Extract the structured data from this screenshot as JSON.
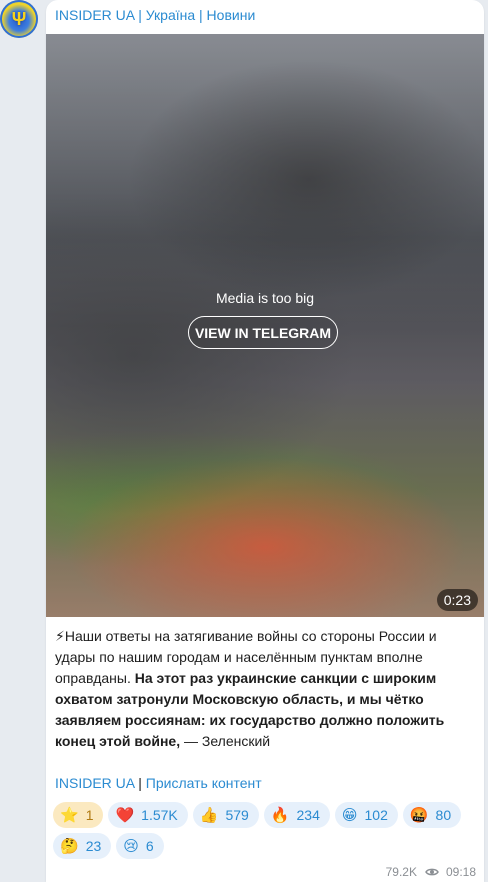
{
  "channel": {
    "name": "INSIDER UA | Україна | Новини"
  },
  "media": {
    "message": "Media is too big",
    "button_label": "VIEW IN TELEGRAM",
    "duration": "0:23"
  },
  "post": {
    "emoji": "⚡",
    "text_regular": "Наши ответы на затягивание войны со стороны России и удары по нашим городам и населённым пунктам вполне оправданы. ",
    "text_bold": "На этот раз украинские санкции с широким охватом затронули Московскую область, и мы чётко заявляем россиянам: их государство должно положить конец этой войне,",
    "text_tail": " — Зеленский"
  },
  "links": {
    "link1": "INSIDER UA",
    "separator": "|",
    "link2": "Прислать контент"
  },
  "reactions": [
    {
      "emoji": "⭐",
      "count": "1"
    },
    {
      "emoji": "❤️",
      "count": "1.57K"
    },
    {
      "emoji": "👍",
      "count": "579"
    },
    {
      "emoji": "🔥",
      "count": "234"
    },
    {
      "emoji": "😁",
      "count": "102"
    },
    {
      "emoji": "🤬",
      "count": "80"
    },
    {
      "emoji": "🤔",
      "count": "23"
    },
    {
      "emoji": "😢",
      "count": "6"
    }
  ],
  "footer": {
    "views": "79.2K",
    "time": "09:18"
  }
}
